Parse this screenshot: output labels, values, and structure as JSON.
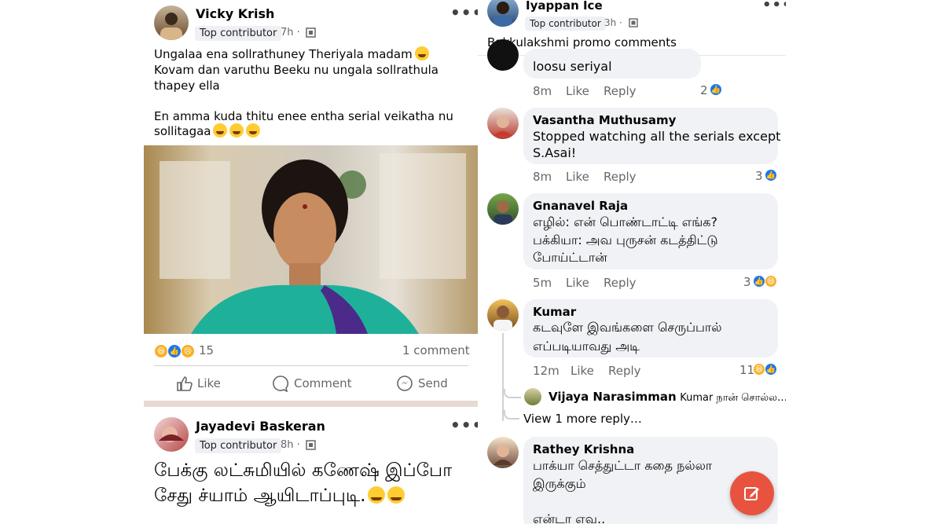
{
  "left_post": {
    "author": "Vicky Krish",
    "badge": "Top contributor",
    "time": "7h ·",
    "body_line1": "Ungalaa ena sollrathuney Theriyala madam",
    "body_line2": "Kovam dan varuthu Beeku nu ungala sollrathula",
    "body_line3": "thapey ella",
    "body_line4": "En amma kuda thitu enee entha serial veikatha nu",
    "body_line5": "sollitagaa",
    "reaction_count": "15",
    "comment_count": "1 comment",
    "actions": {
      "like": "Like",
      "comment": "Comment",
      "send": "Send"
    }
  },
  "left_post2": {
    "author": "Jayadevi Baskeran",
    "badge": "Top contributor",
    "time": "8h ·",
    "body_line1": "பேக்கு லட்சுமியில் கணேஷ் இப்போ",
    "body_line2": "சேது ச்யாம் ஆயிடாப்புடி."
  },
  "right_post": {
    "author": "Iyappan Ice",
    "badge": "Top contributor",
    "time": "3h ·",
    "title": "Bakkulakshmi promo comments"
  },
  "comments": [
    {
      "name": "",
      "text1": "loosu seriyal",
      "text2": "",
      "text3": "",
      "time": "8m",
      "like": "Like",
      "reply": "Reply",
      "count": "2"
    },
    {
      "name": "Vasantha Muthusamy",
      "text1": "Stopped watching all the serials except",
      "text2": "S.Asai!",
      "text3": "",
      "time": "8m",
      "like": "Like",
      "reply": "Reply",
      "count": "3"
    },
    {
      "name": "Gnanavel Raja",
      "text1": "எழில்: என் பொண்டாட்டி எங்க?",
      "text2": "பக்கியா: அவ புருசன் கடத்திட்டு",
      "text3": "போய்ட்டான்",
      "time": "5m",
      "like": "Like",
      "reply": "Reply",
      "count": "3"
    },
    {
      "name": "Kumar",
      "text1": "கடவுளே இவங்களை செருப்பால்",
      "text2": "எப்படியாவது அடி",
      "text3": "",
      "time": "12m",
      "like": "Like",
      "reply": "Reply",
      "count": "11"
    },
    {
      "name": "Rathey Krishna",
      "text1": "பாக்யா செத்துட்டா கதை நல்லா",
      "text2": "இருக்கும்",
      "text3": "என்டா எவ..",
      "time": "",
      "like": "",
      "reply": "",
      "count": ""
    }
  ],
  "reply_preview": {
    "name": "Vijaya Narasimman",
    "text": "Kumar நான் சொல்ல…"
  },
  "view_more": "View 1 more reply…",
  "colors": {
    "fb_blue": "#1877f2",
    "fab_red": "#e8533f",
    "muted": "#65676b",
    "bubble": "#f0f2f5"
  }
}
